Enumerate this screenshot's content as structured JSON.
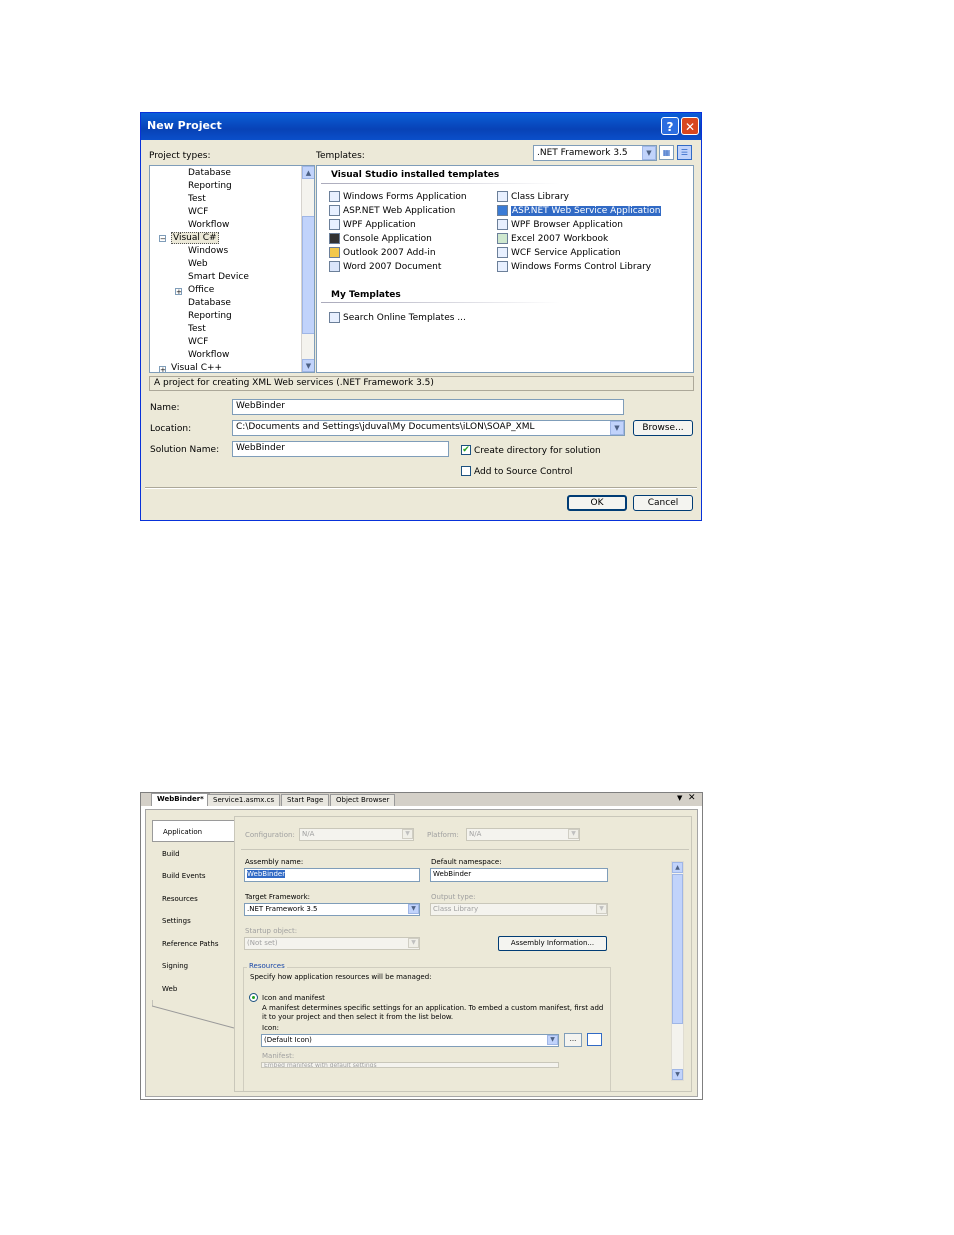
{
  "dialog": {
    "title": "New Project",
    "help_glyph": "?",
    "close_glyph": "✕",
    "project_types_label": "Project types:",
    "templates_label": "Templates:",
    "framework": ".NET Framework 3.5",
    "project_types": [
      "Database",
      "Reporting",
      "Test",
      "WCF",
      "Workflow",
      "Visual C#",
      "Windows",
      "Web",
      "Smart Device",
      "Office",
      "Database",
      "Reporting",
      "Test",
      "WCF",
      "Workflow",
      "Visual C++"
    ],
    "installed_header": "Visual Studio installed templates",
    "templates_left": [
      "Windows Forms Application",
      "ASP.NET Web Application",
      "WPF Application",
      "Console Application",
      "Outlook 2007 Add-in",
      "Word 2007 Document"
    ],
    "templates_right": [
      "Class Library",
      "ASP.NET Web Service Application",
      "WPF Browser Application",
      "Excel 2007 Workbook",
      "WCF Service Application",
      "Windows Forms Control Library"
    ],
    "my_templates_header": "My Templates",
    "search_online": "Search Online Templates ...",
    "description": "A project for creating XML Web services (.NET Framework 3.5)",
    "name_label": "Name:",
    "name_value": "WebBinder",
    "location_label": "Location:",
    "location_value": "C:\\Documents and Settings\\jduval\\My Documents\\iLON\\SOAP_XML",
    "browse_label": "Browse...",
    "solution_label": "Solution Name:",
    "solution_value": "WebBinder",
    "create_dir_label": "Create directory for solution",
    "create_dir_checked": true,
    "source_control_label": "Add to Source Control",
    "source_control_checked": false,
    "ok_label": "OK",
    "cancel_label": "Cancel"
  },
  "designer": {
    "tabs": [
      "WebBinder*",
      "Service1.asmx.cs",
      "Start Page",
      "Object Browser"
    ],
    "side_tabs": [
      "Application",
      "Build",
      "Build Events",
      "Resources",
      "Settings",
      "Reference Paths",
      "Signing",
      "Web"
    ],
    "configuration_label": "Configuration:",
    "configuration_value": "N/A",
    "platform_label": "Platform:",
    "platform_value": "N/A",
    "assembly_name_label": "Assembly name:",
    "assembly_name_value": "WebBinder",
    "default_ns_label": "Default namespace:",
    "default_ns_value": "WebBinder",
    "target_framework_label": "Target Framework:",
    "target_framework_value": ".NET Framework 3.5",
    "output_type_label": "Output type:",
    "output_type_value": "Class Library",
    "startup_label": "Startup object:",
    "startup_value": "(Not set)",
    "assembly_info_label": "Assembly Information...",
    "resources_header": "Resources",
    "resources_desc": "Specify how application resources will be managed:",
    "icon_manifest_label": "Icon and manifest",
    "icon_manifest_desc1": "A manifest determines specific settings for an application. To embed a custom manifest, first add",
    "icon_manifest_desc2": "it to your project and then select it from the list below.",
    "icon_label": "Icon:",
    "icon_value": "(Default Icon)",
    "icon_browse": "...",
    "manifest_label": "Manifest:",
    "manifest_value": "Embed manifest with default settings"
  }
}
